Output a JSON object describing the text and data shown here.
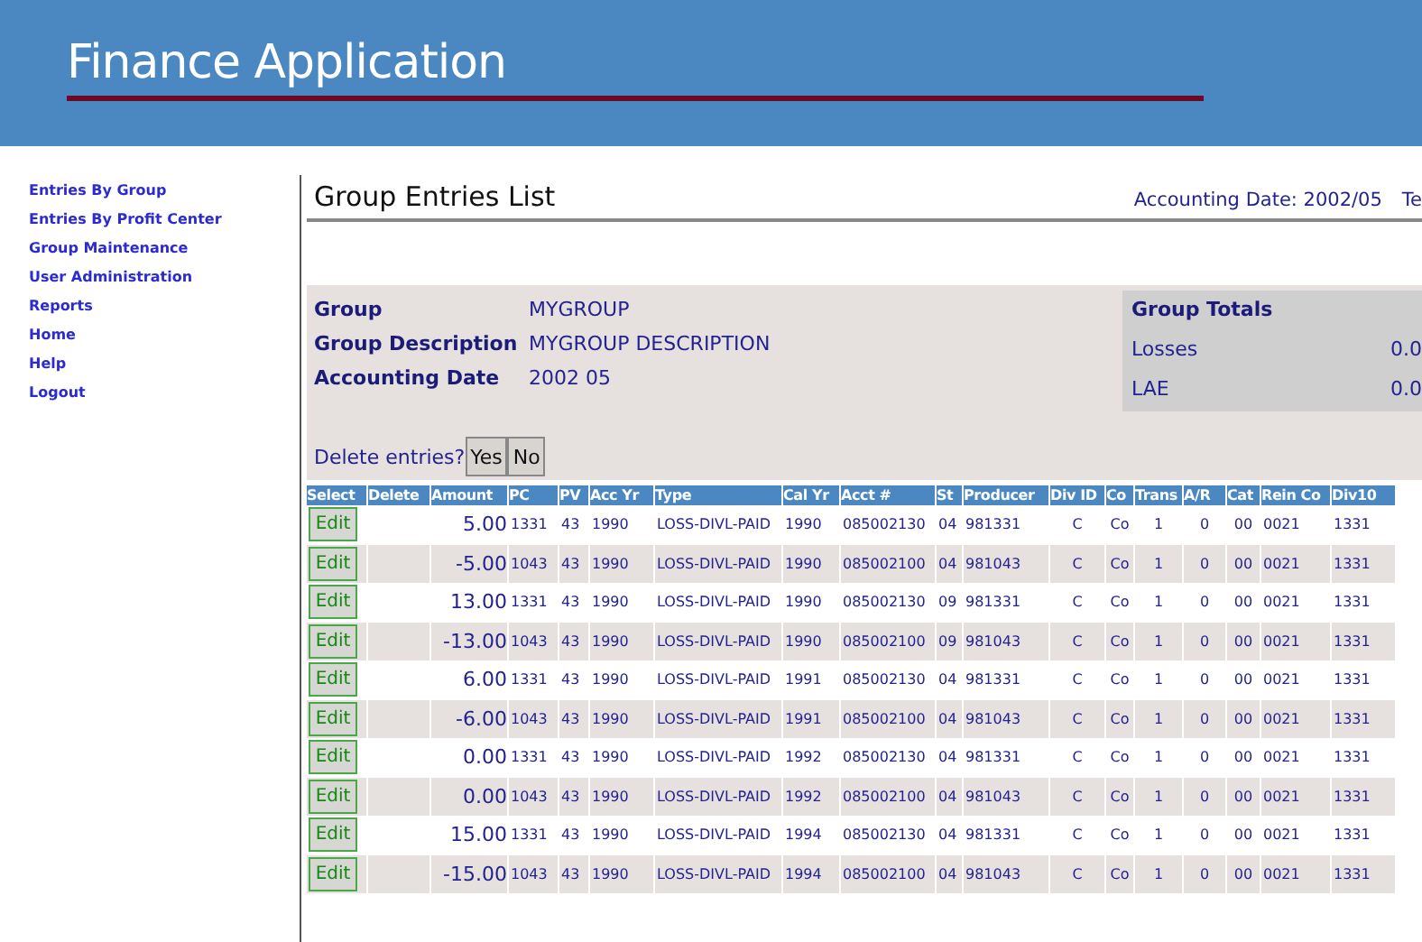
{
  "header": {
    "title": "Finance Application"
  },
  "nav": [
    "Entries By Group",
    "Entries By Profit Center",
    "Group Maintenance",
    "User Administration",
    "Reports",
    "Home",
    "Help",
    "Logout"
  ],
  "page": {
    "title": "Group Entries List",
    "accounting_date": "Accounting Date: 2002/05",
    "cut_text": "Te"
  },
  "group_info": [
    {
      "label": "Group",
      "value": "MYGROUP"
    },
    {
      "label": "Group Description",
      "value": "MYGROUP DESCRIPTION"
    },
    {
      "label": "Accounting Date",
      "value": "2002  05"
    }
  ],
  "group_totals": {
    "title": "Group Totals",
    "rows": [
      {
        "label": "Losses",
        "value": "0.0"
      },
      {
        "label": "LAE",
        "value": "0.0"
      }
    ]
  },
  "delete_prompt": {
    "text": "Delete entries?",
    "buttons": [
      "Yes",
      "No"
    ]
  },
  "table": {
    "columns": [
      "Select",
      "Delete",
      "Amount",
      "PC",
      "PV",
      "Acc Yr",
      "Type",
      "Cal Yr",
      "Acct #",
      "St",
      "Producer",
      "Div ID",
      "Co",
      "Trans",
      "A/R",
      "Cat",
      "Rein Co",
      "Div10"
    ],
    "rows": [
      [
        "Edit",
        "",
        "5.00",
        "1331",
        "43",
        "1990",
        "LOSS-DIVL-PAID",
        "1990",
        "085002130",
        "04",
        "981331",
        "C",
        "Co",
        "1",
        "0",
        "00",
        "0021",
        "1331"
      ],
      [
        "Edit",
        "",
        "-5.00",
        "1043",
        "43",
        "1990",
        "LOSS-DIVL-PAID",
        "1990",
        "085002100",
        "04",
        "981043",
        "C",
        "Co",
        "1",
        "0",
        "00",
        "0021",
        "1331"
      ],
      [
        "Edit",
        "",
        "13.00",
        "1331",
        "43",
        "1990",
        "LOSS-DIVL-PAID",
        "1990",
        "085002130",
        "09",
        "981331",
        "C",
        "Co",
        "1",
        "0",
        "00",
        "0021",
        "1331"
      ],
      [
        "Edit",
        "",
        "-13.00",
        "1043",
        "43",
        "1990",
        "LOSS-DIVL-PAID",
        "1990",
        "085002100",
        "09",
        "981043",
        "C",
        "Co",
        "1",
        "0",
        "00",
        "0021",
        "1331"
      ],
      [
        "Edit",
        "",
        "6.00",
        "1331",
        "43",
        "1990",
        "LOSS-DIVL-PAID",
        "1991",
        "085002130",
        "04",
        "981331",
        "C",
        "Co",
        "1",
        "0",
        "00",
        "0021",
        "1331"
      ],
      [
        "Edit",
        "",
        "-6.00",
        "1043",
        "43",
        "1990",
        "LOSS-DIVL-PAID",
        "1991",
        "085002100",
        "04",
        "981043",
        "C",
        "Co",
        "1",
        "0",
        "00",
        "0021",
        "1331"
      ],
      [
        "Edit",
        "",
        "0.00",
        "1331",
        "43",
        "1990",
        "LOSS-DIVL-PAID",
        "1992",
        "085002130",
        "04",
        "981331",
        "C",
        "Co",
        "1",
        "0",
        "00",
        "0021",
        "1331"
      ],
      [
        "Edit",
        "",
        "0.00",
        "1043",
        "43",
        "1990",
        "LOSS-DIVL-PAID",
        "1992",
        "085002100",
        "04",
        "981043",
        "C",
        "Co",
        "1",
        "0",
        "00",
        "0021",
        "1331"
      ],
      [
        "Edit",
        "",
        "15.00",
        "1331",
        "43",
        "1990",
        "LOSS-DIVL-PAID",
        "1994",
        "085002130",
        "04",
        "981331",
        "C",
        "Co",
        "1",
        "0",
        "00",
        "0021",
        "1331"
      ],
      [
        "Edit",
        "",
        "-15.00",
        "1043",
        "43",
        "1990",
        "LOSS-DIVL-PAID",
        "1994",
        "085002100",
        "04",
        "981043",
        "C",
        "Co",
        "1",
        "0",
        "00",
        "0021",
        "1331"
      ]
    ]
  }
}
